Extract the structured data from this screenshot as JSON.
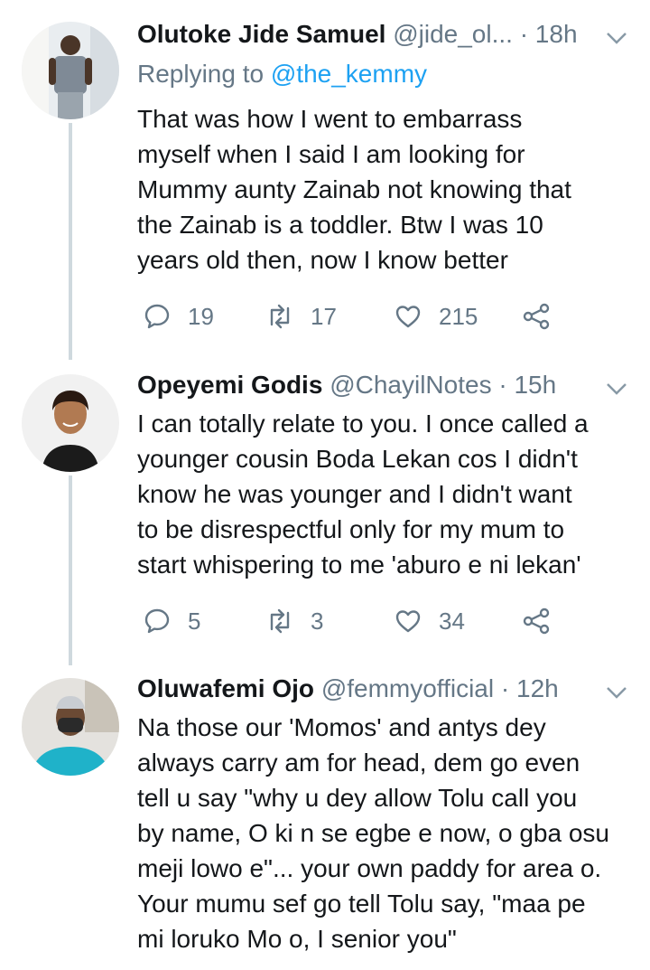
{
  "tweets": [
    {
      "name": "Olutoke Jide Samuel",
      "handle": "@jide_ol...",
      "time": "· 18h",
      "reply_prefix": "Replying to",
      "reply_handle": "@the_kemmy",
      "lines": [
        "That was how I went to embarrass",
        "myself when I said I am looking for",
        "Mummy aunty Zainab not knowing that",
        "the Zainab is a toddler. Btw I was 10",
        "years old then, now I know better"
      ],
      "replies": "19",
      "retweets": "17",
      "likes": "215"
    },
    {
      "name": "Opeyemi Godis",
      "handle": "@ChayilNotes",
      "time": "· 15h",
      "lines": [
        "I can totally relate to you. I once called a",
        "younger cousin Boda Lekan cos I didn't",
        "know he was younger and I didn't want",
        "to be disrespectful only for my mum to",
        "start whispering to me 'aburo e ni lekan'"
      ],
      "replies": "5",
      "retweets": "3",
      "likes": "34"
    },
    {
      "name": "Oluwafemi Ojo",
      "handle": "@femmyofficial",
      "time": "· 12h",
      "lines": [
        "Na those our 'Momos' and antys dey",
        "always carry am for head, dem go even",
        "tell u say \"why u dey allow Tolu call you",
        "by name, O ki n se egbe e now, o gba osu",
        "meji lowo e\"... your own paddy for area o.",
        "Your mumu sef go tell Tolu say, \"maa pe",
        "mi loruko Mo o, I senior you\""
      ]
    }
  ],
  "colors": {
    "text": "#14171a",
    "secondary": "#657786",
    "link": "#1da1f2",
    "thread": "#cfd9de"
  },
  "icons": [
    "reply-icon",
    "retweet-icon",
    "like-icon",
    "share-icon",
    "chevron-down-icon"
  ]
}
